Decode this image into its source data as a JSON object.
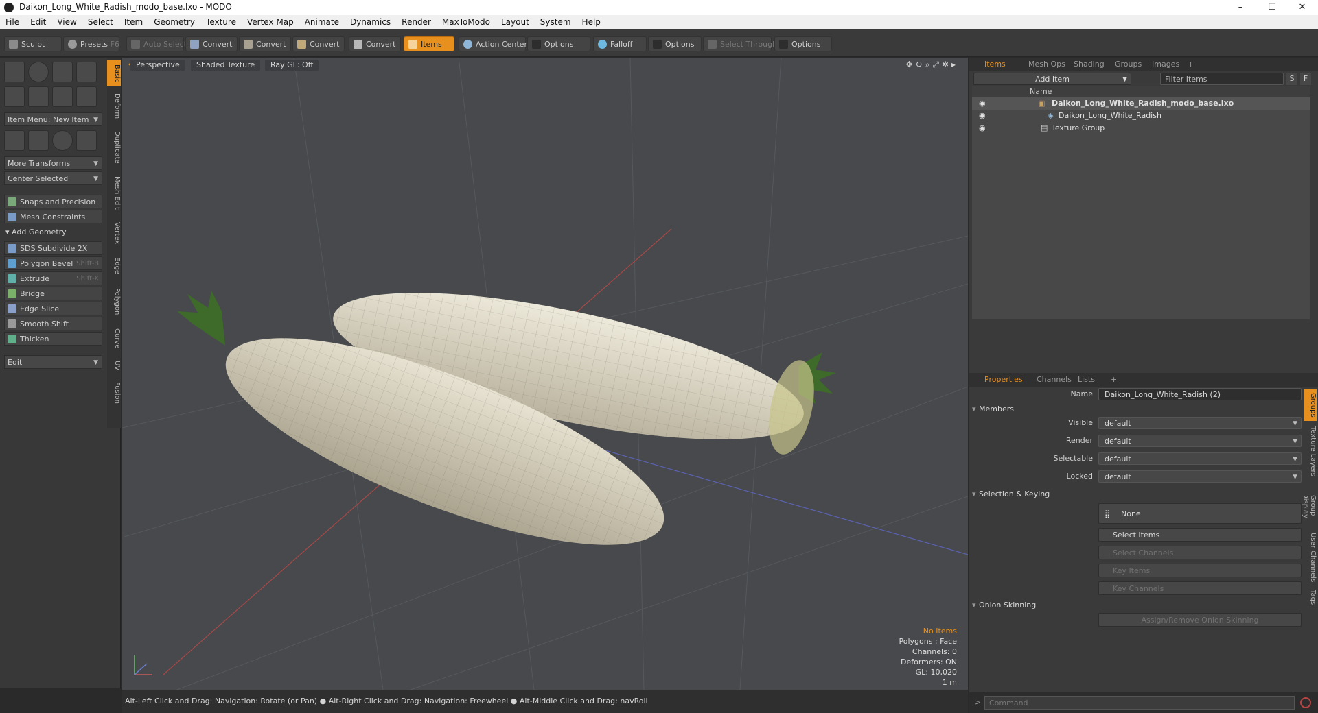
{
  "window": {
    "title": "Daikon_Long_White_Radish_modo_base.lxo - MODO",
    "min": "–",
    "max": "☐",
    "close": "✕"
  },
  "menu": [
    "File",
    "Edit",
    "View",
    "Select",
    "Item",
    "Geometry",
    "Texture",
    "Vertex Map",
    "Animate",
    "Dynamics",
    "Render",
    "MaxToModo",
    "Layout",
    "System",
    "Help"
  ],
  "toolbar": {
    "sculpt": "Sculpt",
    "presets": "Presets",
    "presets_key": "F6",
    "auto_select": "Auto Select",
    "convert1": "Convert",
    "convert2": "Convert",
    "convert3": "Convert",
    "convert4": "Convert",
    "items": "Items",
    "action_center": "Action Center",
    "options1": "Options",
    "falloff": "Falloff",
    "options2": "Options",
    "select_through": "Select Through",
    "options3": "Options"
  },
  "left": {
    "item_menu": "Item Menu: New Item",
    "more_transforms": "More Transforms",
    "center_selected": "Center Selected",
    "snaps": "Snaps and Precision",
    "mesh_constraints": "Mesh Constraints",
    "add_geometry": "Add Geometry",
    "tools": [
      {
        "label": "SDS Subdivide 2X",
        "key": ""
      },
      {
        "label": "Polygon Bevel",
        "key": "Shift-B"
      },
      {
        "label": "Extrude",
        "key": "Shift-X"
      },
      {
        "label": "Bridge",
        "key": ""
      },
      {
        "label": "Edge Slice",
        "key": ""
      },
      {
        "label": "Smooth Shift",
        "key": ""
      },
      {
        "label": "Thicken",
        "key": ""
      }
    ],
    "edit": "Edit",
    "vtabs": [
      "Basic",
      "Deform",
      "Duplicate",
      "Mesh Edit",
      "Vertex",
      "Edge",
      "Polygon",
      "Curve",
      "UV",
      "Fusion"
    ]
  },
  "viewport": {
    "perspective": "Perspective",
    "shading": "Shaded Texture",
    "raygl": "Ray GL: Off",
    "hud": {
      "no_items": "No Items",
      "polygons": "Polygons : Face",
      "channels": "Channels: 0",
      "deformers": "Deformers: ON",
      "gl": "GL: 10,020",
      "scale": "1 m"
    }
  },
  "status": "Alt-Left Click and Drag: Navigation: Rotate (or Pan) ● Alt-Right Click and Drag: Navigation: Freewheel ● Alt-Middle Click and Drag: navRoll",
  "items_panel": {
    "tabs": [
      "Items",
      "Mesh Ops",
      "Shading",
      "Groups",
      "Images"
    ],
    "plus": "+",
    "add_item": "Add Item",
    "filter": "Filter Items",
    "s": "S",
    "f": "F",
    "name_header": "Name",
    "tree": [
      "Daikon_Long_White_Radish_modo_base.lxo",
      "Daikon_Long_White_Radish",
      "Texture Group"
    ]
  },
  "props": {
    "tabs": [
      "Properties",
      "Channels",
      "Lists"
    ],
    "plus": "+",
    "name_label": "Name",
    "name_value": "Daikon_Long_White_Radish (2)",
    "members": "Members",
    "visible_label": "Visible",
    "visible": "default",
    "render_label": "Render",
    "render": "default",
    "selectable_label": "Selectable",
    "selectable": "default",
    "locked_label": "Locked",
    "locked": "default",
    "sel_keying": "Selection & Keying",
    "none": "None",
    "select_items": "Select Items",
    "select_channels": "Select Channels",
    "key_items": "Key Items",
    "key_channels": "Key Channels",
    "onion": "Onion Skinning",
    "assign_onion": "Assign/Remove Onion Skinning",
    "vtabs": [
      "Groups",
      "Texture Layers",
      "Group Display",
      "User Channels",
      "Tags"
    ]
  },
  "command": {
    "placeholder": "Command"
  }
}
